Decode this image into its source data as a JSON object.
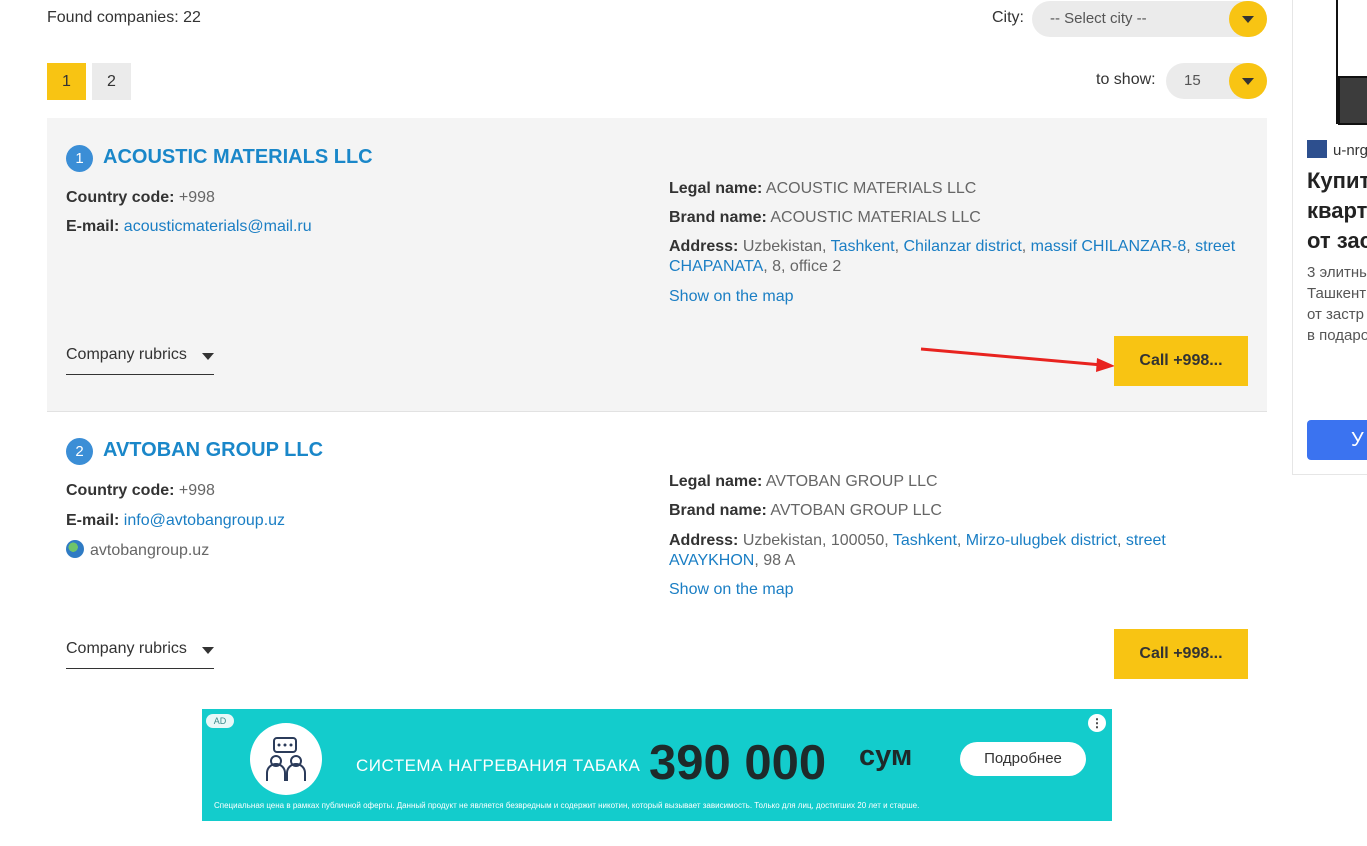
{
  "filters": {
    "found_text": "Found companies: 22",
    "city_label": "City:",
    "city_value": "-- Select city --",
    "show_label": "to show:",
    "show_value": "15"
  },
  "pagination": [
    "1",
    "2"
  ],
  "companies": [
    {
      "number": "1",
      "name": "ACOUSTIC MATERIALS LLC",
      "country_code_label": "Country code:",
      "country_code": "+998",
      "email_label": "E-mail:",
      "email": "acousticmaterials@mail.ru",
      "legal_label": "Legal name:",
      "legal_name": "ACOUSTIC MATERIALS LLC",
      "brand_label": "Brand name:",
      "brand_name": "ACOUSTIC MATERIALS LLC",
      "address_label": "Address:",
      "address_country": "Uzbekistan,",
      "address_links": [
        "Tashkent",
        "Chilanzar district",
        "massif CHILANZAR-8",
        "street CHAPANATA"
      ],
      "address_tail": ", 8, office 2",
      "map_link": "Show on the map",
      "rubrics": "Company rubrics",
      "call": "Call +998..."
    },
    {
      "number": "2",
      "name": "AVTOBAN GROUP LLC",
      "country_code_label": "Country code:",
      "country_code": "+998",
      "email_label": "E-mail:",
      "email": "info@avtobangroup.uz",
      "website": "avtobangroup.uz",
      "legal_label": "Legal name:",
      "legal_name": "AVTOBAN GROUP LLC",
      "brand_label": "Brand name:",
      "brand_name": "AVTOBAN GROUP LLC",
      "address_label": "Address:",
      "address_country": "Uzbekistan, 100050,",
      "address_links": [
        "Tashkent",
        "Mirzo-ulugbek district",
        "street AVAYKHON"
      ],
      "address_tail": ", 98 A",
      "map_link": "Show on the map",
      "rubrics": "Company rubrics",
      "call": "Call +998..."
    }
  ],
  "ad": {
    "tag": "AD",
    "headline": "СИСТЕМА НАГРЕВАНИЯ ТАБАКА",
    "price": "390 000",
    "currency": "сум",
    "button": "Подробнее",
    "fine_print": "Специальная цена в рамках публичной оферты. Данный продукт не является безвредным и содержит никотин, который вызывает зависимость. Только для лиц, достигших 20 лет и старше.",
    "accent_color": "#13cccc"
  },
  "side_ad": {
    "source": "u-nrg",
    "headline": [
      "Купит",
      "кварт",
      "от зас"
    ],
    "description": [
      "3 элитны",
      "Ташкент",
      "от застр",
      "в подаро"
    ],
    "button": "У"
  },
  "colors": {
    "accent": "#f8c413",
    "link": "#1a87c9",
    "badge": "#3b8ed6"
  }
}
